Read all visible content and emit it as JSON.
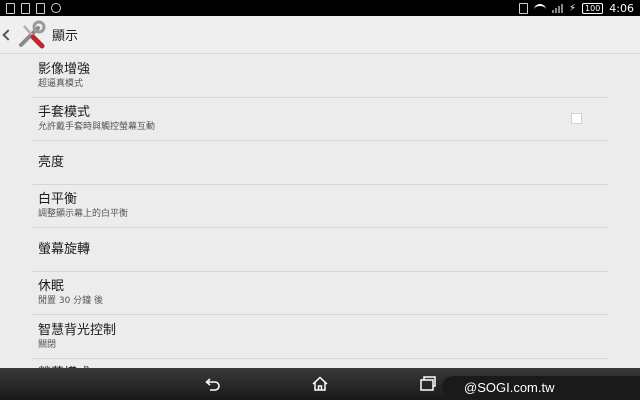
{
  "status_bar": {
    "time": "4:06",
    "battery": "100"
  },
  "action_bar": {
    "title": "顯示"
  },
  "settings": [
    {
      "label": "影像增強",
      "sub": "超逼真模式"
    },
    {
      "label": "手套模式",
      "sub": "允許戴手套時與觸控螢幕互動",
      "checkbox": false
    },
    {
      "label": "亮度",
      "sub": ""
    },
    {
      "label": "白平衡",
      "sub": "調整顯示幕上的白平衡"
    },
    {
      "label": "螢幕旋轉",
      "sub": ""
    },
    {
      "label": "休眠",
      "sub": "閒置 30 分鐘 後"
    },
    {
      "label": "智慧背光控制",
      "sub": "關閉"
    },
    {
      "label": "螢幕模式",
      "sub": ""
    }
  ],
  "watermark": "@SOGI.com.tw"
}
